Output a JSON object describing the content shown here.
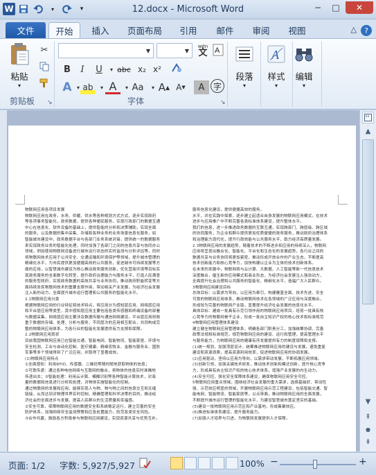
{
  "window": {
    "title": "12.docx - Microsoft Word",
    "app_icon": "W",
    "minimize": "−",
    "maximize": "□",
    "close": "✕"
  },
  "quick_access": {
    "save_icon": "save-icon",
    "undo_icon": "undo-icon",
    "redo_icon": "redo-icon"
  },
  "tabs": [
    {
      "label": "文件"
    },
    {
      "label": "开始"
    },
    {
      "label": "插入"
    },
    {
      "label": "页面布局"
    },
    {
      "label": "引用"
    },
    {
      "label": "邮件"
    },
    {
      "label": "审阅"
    },
    {
      "label": "视图"
    }
  ],
  "ribbon": {
    "clipboard": {
      "paste_label": "粘贴",
      "group_label": "剪贴板"
    },
    "font": {
      "group_label": "字体",
      "font_name": "",
      "font_size": "",
      "bold": "B",
      "italic": "I",
      "underline": "U",
      "strikethrough": "abc",
      "subscript": "x₂",
      "superscript": "x²",
      "text_effects": "A",
      "highlight": "ab",
      "font_color": "A",
      "change_case": "Aa",
      "grow": "A",
      "shrink": "A",
      "phonetic": "wén",
      "char_shading": "A",
      "enclose": "字"
    },
    "paragraph": {
      "label": "段落"
    },
    "styles": {
      "label": "样式"
    },
    "editing": {
      "label": "编辑"
    }
  },
  "document": {
    "left_column": [
      "物联网应用各项目发展",
      "物联网应用在政务，水务、供暖、供水等各种规划方式方式，逐步实现政府",
      "等各项事务智能化，政务数据，提供各种便民服务，实现行政部门的数据互通",
      "中心在信息化、软件设备的基础上，提供智能的分析和决策辅助，实现全面",
      "的服务，以及数据的集中采集、存储和各种业务的业务场景信息化服务，如",
      "智能城市建设中，政务数据平台与各部门业务系统对接，提供统一的数据服务",
      "来实现政务业务的智能化处理，同时加强了各部门之间的信息共享与协同办公",
      "领域，例如使用物联网设备进行城市运行状态的实时监测与分析评估等，同时",
      "将物联网技术应用于公共安全、交通运输和环境保护等领域，提升城市管理的",
      "精细化水平，为市民提供更加便捷高效的公共服务，促进城市可持续发展等方",
      "面的应用，以智慧城市建设为核心推动政务服务创新，优化营商环境等目标实",
      "现政务服务的全面数字化转型，提升政府治理能力与服务水平，打造人民满意",
      "的服务型政府，实现政务数据的高效共享与业务协同，推动政府职能转变等方",
      "面持续发挥物联网技术的重要支撑作用，带动相关产业发展，为经济社会发展",
      "注入新的动力，全面提升城市运行管理和公共服务的智能化水平。",
      "2.1物联网应用分类",
      "根据物联网应用的行业特征和技术特点，将应用分为感知层应用、网络层应用",
      "和平台层应用等类型，其中感知层应用主要包括各类传感器和终端设备的部署",
      "与数据采集，网络层应用主要涉及数据传输与通信网络建设，平台层应用则侧",
      "重于数据的存储、处理、分析与服务，不同层次的应用相互配合，共同构成完",
      "整的物联网应用体系，为各行业的智能化发展提供有力支撑和保障。",
      "2.2物联网应用现状",
      "目前我国物联网应用已在智能交通、智能电网、智能物流、智能家居、环境与",
      "安全检测、工业与自动化控制、医疗健康、精细农牧业、金融与服务业、国防",
      "军事等多个领域得到了广泛应用，并取得了显著成效。",
      "(1)物联网应用特点",
      "①全面感知：利用RFID、传感器、二维码等随时随地获取物体的信息；",
      "②可靠传递：通过各种电信网络与互联网的融合，将物体的信息实时准确地",
      "传递出去；③智能处理：利用云计算、模糊识别等各种智能计算技术，对海",
      "量的数据和信息进行分析和处理，对物体实施智能化的控制。",
      "通过物联网的发展和应用，能够实现人与物、物与物之间的信息交互和无缝",
      "链接，从而达到对物理世界实时控制、精确管理和科学决策的目的，推动经",
      "济社会的全面进步与发展，提高人民群众的生活质量和幸福感。",
      "②安全可靠，保障物联网应用的数据安全和系统稳定运行，建立完善的安全",
      "防护体系，加强网络安全监测预警和应急处置能力，防范各类安全风险。",
      "③合作共赢，鼓励各方积极参与物联网应用建设，实现资源共享与优势互补。"
    ],
    "right_column": [
      "服务信息化建设，提供便捷高效的服务。",
      "水平，并在实践中探索，逐步建立起适合自身发展的物联网应用模式，在技术",
      "进步与应用推广中不断完善各类标准体系建设，提升整体水平。",
      "我们的信息，进一步推进政务数据的互联互通，实现跨部门、跨层级、跨区域",
      "的协同服务，为企业和群众提供更加优质便捷的政务服务，推动政府治理体系",
      "和治理能力现代化，提升行政效能与公共服务水平，助力经济高质量发展。",
      "2.3物联网应用的发展趋势，随着技术的不断进步和应用的持续深入，物联网",
      "应用将呈现出融合化、智能化、平台化和生态化的发展趋势，各行业之间的",
      "数据共享与业务协同将更加紧密，推动形成开放合作的产业生态，不断提高",
      "技术创新能力和核心竞争力，加快构建以企业为主体的技术创新体系。",
      "在未来的发展中，物联网将与云计算、大数据、人工智能等新一代信息技术",
      "深度融合，催生新的应用模式和商业形态，为经济社会发展注入强劲动力，",
      "全面提升社会治理和公共服务的智能化、精细化水平，造福广大人民群众。",
      "3物联网应用建设目标",
      "总体目标：以需求为导向，以应用为牵引，构建覆盖全面、技术先进、安全",
      "可靠的物联网应用体系，推动物联网技术在各领域的广泛应用与深度融合，",
      "形成较为完善的物联网产业链，显著提升经济社会发展的信息化水平。",
      "具体目标：建成一批具有示范引领作用的物联网应用项目，培育一批具有核",
      "心竞争力的物联网骨干企业，形成一批自主知识产权的核心技术和标准规范",
      "4物联网应用管理体系建设",
      "建立健全物联网应用管理体系，明确各部门职责分工，加强统筹协调，完善",
      "政策法规和标准规范，规范物联网应用的建设、运行和管理，提高管理水平",
      "与服务能力，为物联网应用的健康有序发展提供有力的制度保障和支撑。",
      "(1)统一规划，加强顶层设计，统筹推进物联网应用的建设与发展，避免重复",
      "建设和资源浪费，提高资源利用效率，促进物联网应用的协调发展。",
      "(2)应用驱动，坚持以应用为导向，以需求带动发展，不断拓展应用领域。",
      "(3)创新引领，加强关键技术研发，推动技术创新和模式创新，提升核心竞争",
      "力，形成具有自主知识产权的核心技术体系，增强产业发展的内生动力。",
      "(4)安全可控，强化安全保障体系建设，确保物联网应用安全可控。",
      "5物联网应用重点领域，围绕经济社会发展的重大需求，选择基础好、带动性",
      "强、示范效应明显的领域，开展物联网应用示范工程建设，包括智能交通、智",
      "能电网、智能物流、智能家居等，以点带面，推动物联网应用的全面发展，",
      "不断提升城市运行管理的智能化水平，为建设智慧城市奠定坚实的基础。",
      "(5)建设一批物联网应用示范区和产业基地，形成集聚效应。",
      "(6)推进标准体系建设，提升服务能力。",
      "(7)加强人才培养与引进，为物联网发展提供人才保障。"
    ]
  },
  "status_bar": {
    "page": "页面: 1/2",
    "words": "字数: 5,927/5,927",
    "zoom": "100%",
    "zoom_out": "−",
    "zoom_in": "+"
  }
}
